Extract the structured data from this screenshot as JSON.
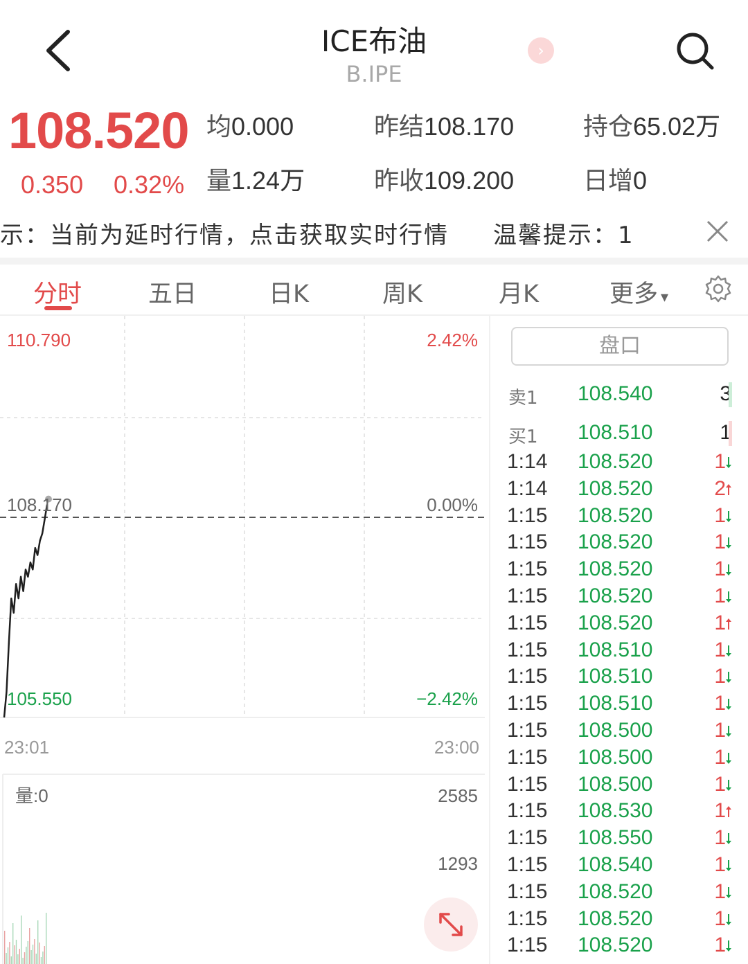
{
  "header": {
    "title": "ICE布油",
    "subtitle": "B.IPE",
    "pink_dot_glyph": "›"
  },
  "quote": {
    "price": "108.520",
    "change": "0.350",
    "change_pct": "0.32%",
    "stats": [
      {
        "label": "均",
        "value": "0.000"
      },
      {
        "label": "昨结",
        "value": "108.170"
      },
      {
        "label": "持仓",
        "value": "65.02万"
      },
      {
        "label": "量",
        "value": "1.24万"
      },
      {
        "label": "昨收",
        "value": "109.200"
      },
      {
        "label": "日增",
        "value": "0"
      }
    ]
  },
  "notice": {
    "text": "提示：当前为延时行情，点击获取实时行情",
    "text2": "温馨提示：1"
  },
  "tabs": [
    "分时",
    "五日",
    "日K",
    "周K",
    "月K",
    "更多"
  ],
  "tabs_more_caret": "▾",
  "chart": {
    "price_high": "110.790",
    "pct_high": "2.42%",
    "price_mid": "108.170",
    "pct_mid": "0.00%",
    "price_low": "105.550",
    "pct_low": "−2.42%",
    "time_start": "23:01",
    "time_end": "23:00",
    "volume_label": "量:0",
    "vol_max": "2585",
    "vol_mid": "1293"
  },
  "chart_data": {
    "type": "line",
    "title": "",
    "xlabel": "",
    "ylabel": "",
    "ylim": [
      105.55,
      110.79
    ],
    "reference_value": 108.17,
    "x_range": [
      "23:01",
      "23:00"
    ],
    "y_right_range_pct": [
      "-2.42%",
      "2.42%"
    ],
    "volume_axis": [
      0,
      2585
    ],
    "series": [
      {
        "values": [
          105.55,
          105.9,
          106.6,
          107.2,
          107.0,
          107.4,
          107.2,
          107.5,
          107.3,
          107.6,
          107.5,
          107.7,
          107.6,
          107.9,
          107.8,
          108.0,
          108.1,
          108.3,
          108.5
        ]
      }
    ]
  },
  "orderbook": {
    "title": "盘口",
    "sell": {
      "label": "卖1",
      "price": "108.540",
      "vol": "3"
    },
    "buy": {
      "label": "买1",
      "price": "108.510",
      "vol": "1"
    },
    "colors": {
      "up": "#e24a4a",
      "down": "#1aa14b"
    },
    "ticks": [
      {
        "time": "1:14",
        "price": "108.520",
        "vol": "1",
        "dir": "down"
      },
      {
        "time": "1:14",
        "price": "108.520",
        "vol": "2",
        "dir": "up"
      },
      {
        "time": "1:15",
        "price": "108.520",
        "vol": "1",
        "dir": "down"
      },
      {
        "time": "1:15",
        "price": "108.520",
        "vol": "1",
        "dir": "down"
      },
      {
        "time": "1:15",
        "price": "108.520",
        "vol": "1",
        "dir": "down"
      },
      {
        "time": "1:15",
        "price": "108.520",
        "vol": "1",
        "dir": "down"
      },
      {
        "time": "1:15",
        "price": "108.520",
        "vol": "1",
        "dir": "up"
      },
      {
        "time": "1:15",
        "price": "108.510",
        "vol": "1",
        "dir": "down"
      },
      {
        "time": "1:15",
        "price": "108.510",
        "vol": "1",
        "dir": "down"
      },
      {
        "time": "1:15",
        "price": "108.510",
        "vol": "1",
        "dir": "down"
      },
      {
        "time": "1:15",
        "price": "108.500",
        "vol": "1",
        "dir": "down"
      },
      {
        "time": "1:15",
        "price": "108.500",
        "vol": "1",
        "dir": "down"
      },
      {
        "time": "1:15",
        "price": "108.500",
        "vol": "1",
        "dir": "down"
      },
      {
        "time": "1:15",
        "price": "108.530",
        "vol": "1",
        "dir": "up"
      },
      {
        "time": "1:15",
        "price": "108.550",
        "vol": "1",
        "dir": "down"
      },
      {
        "time": "1:15",
        "price": "108.540",
        "vol": "1",
        "dir": "down"
      },
      {
        "time": "1:15",
        "price": "108.520",
        "vol": "1",
        "dir": "down"
      },
      {
        "time": "1:15",
        "price": "108.520",
        "vol": "1",
        "dir": "down"
      },
      {
        "time": "1:15",
        "price": "108.520",
        "vol": "1",
        "dir": "down"
      }
    ]
  }
}
